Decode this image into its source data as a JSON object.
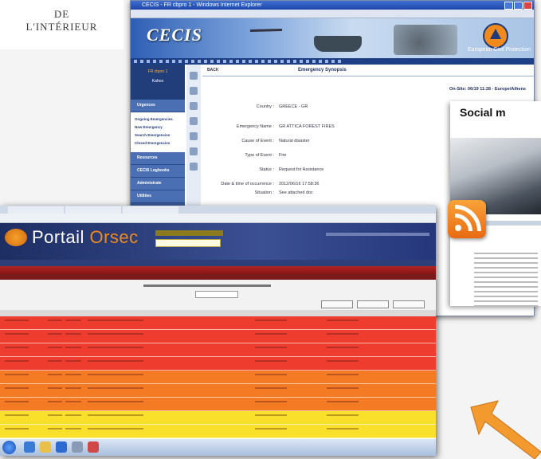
{
  "logo": {
    "line1": "DE",
    "line2": "L'INTÉRIEUR"
  },
  "cecis": {
    "window_title": "CECIS - FR cbpro 1 - Windows Internet Explorer",
    "brand": "CECIS",
    "eu_label": "European Civil Protection",
    "sidebar": {
      "user": "FR cbpro 1",
      "logout": "Kahoo",
      "groups": [
        "Urgences",
        "Resources",
        "CECIS Logbooks",
        "Administrate",
        "Utilities"
      ],
      "items": [
        "Ongoing Emergencies",
        "New Emergency",
        "Search Emergencies",
        "Closed Emergencies"
      ]
    },
    "main": {
      "back": "BACK",
      "page_title": "Emergency Synopsis",
      "onsite": "On-Site: 06/19 11:28 - Europe/Athens",
      "fields": [
        {
          "key": "Country :",
          "value": "GREECE - GR"
        },
        {
          "key": "Emergency Name :",
          "value": "GR ATTICA FOREST FIRES"
        },
        {
          "key": "Cause of Event :",
          "value": "Natural disaster"
        },
        {
          "key": "Type of Event :",
          "value": "Fire"
        },
        {
          "key": "Status :",
          "value": "Request for Assistance"
        },
        {
          "key": "Date & time of occurrence :",
          "value": "2012/06/16 17:58:36"
        },
        {
          "key": "Situation :",
          "value": "See attached doc"
        }
      ]
    }
  },
  "social": {
    "title": "Social m"
  },
  "orsec": {
    "brand_a": "Portail",
    "brand_b": " Orsec",
    "row_colors": [
      "#ee3c2e",
      "#ee3c2e",
      "#ee3c2e",
      "#ee3c2e",
      "#f47a24",
      "#f47a24",
      "#f47a24",
      "#f9e02a",
      "#f9e02a"
    ]
  },
  "colors": {
    "cecis_blue": "#2f5fb5",
    "orsec_navy": "#1d2e63",
    "arrow_orange": "#f39a2e"
  }
}
